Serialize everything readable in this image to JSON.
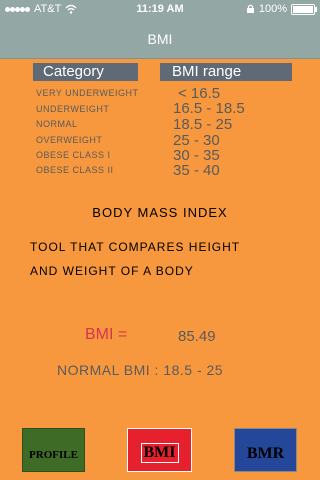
{
  "status_bar": {
    "carrier": "AT&T",
    "time": "11:19 AM",
    "battery": "100%",
    "battery_level": 1.0,
    "signal_bars": 5
  },
  "nav": {
    "title": "BMI"
  },
  "table": {
    "headers": {
      "category": "Category",
      "range": "BMI range"
    },
    "rows": [
      {
        "category": "VERY UNDERWEIGHT",
        "range": "< 16.5"
      },
      {
        "category": "UNDERWEIGHT",
        "range": "16.5 - 18.5"
      },
      {
        "category": "NORMAL",
        "range": "18.5 - 25"
      },
      {
        "category": "OVERWEIGHT",
        "range": "25 - 30"
      },
      {
        "category": "OBESE CLASS  I",
        "range": "30 - 35"
      },
      {
        "category": "OBESE CLASS  II",
        "range": "35 - 40"
      }
    ]
  },
  "info": {
    "heading": "BODY MASS INDEX",
    "description_line1": "TOOL THAT COMPARES HEIGHT",
    "description_line2": "AND WEIGHT OF A BODY"
  },
  "result": {
    "label": "BMI =",
    "value": "85.49",
    "normal_range": "NORMAL  BMI :  18.5 - 25"
  },
  "tabs": {
    "profile": "PROFILE",
    "bmi": "BMI",
    "bmr": "BMR"
  },
  "colors": {
    "background": "#f7983f",
    "navbar": "#93a7a5",
    "header_cell": "#5f6a76",
    "bmi_label": "#d6354e",
    "tab_profile": "#3e6b26",
    "tab_bmi": "#e6212d",
    "tab_bmr": "#24479a"
  }
}
